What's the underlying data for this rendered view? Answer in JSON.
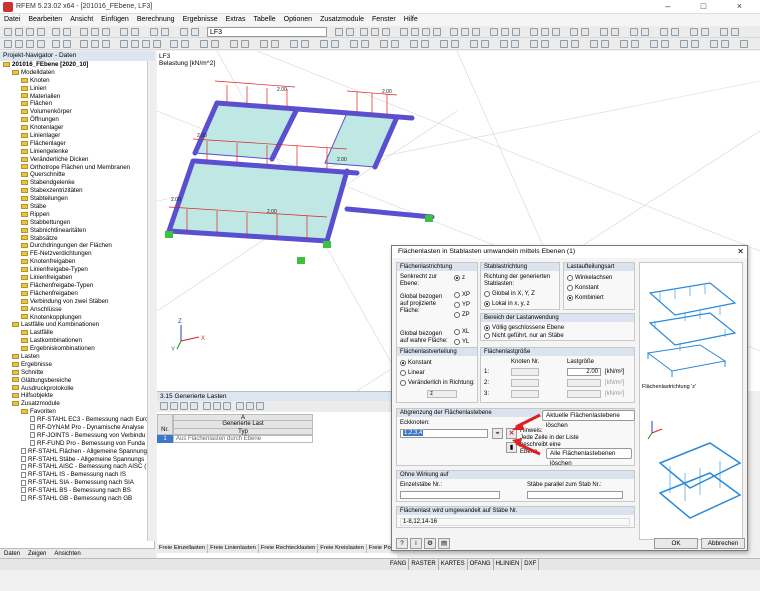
{
  "app": {
    "title": "RFEM 5.23.02 x64 - [201016_FEbene, LF3]",
    "load_case": "LF3",
    "menu": [
      "Datei",
      "Bearbeiten",
      "Ansicht",
      "Einfügen",
      "Berechnung",
      "Ergebnisse",
      "Extras",
      "Tabelle",
      "Optionen",
      "Zusatzmodule",
      "Fenster",
      "Hilfe"
    ]
  },
  "navigator": {
    "title": "Projekt-Navigator - Daten",
    "tree": [
      {
        "label": "201016_FEbene [2020_10]",
        "level": 0,
        "type": "folder"
      },
      {
        "label": "Modelldaten",
        "level": 1,
        "type": "folder"
      },
      {
        "label": "Knoten",
        "level": 2,
        "type": "folder"
      },
      {
        "label": "Linien",
        "level": 2,
        "type": "folder"
      },
      {
        "label": "Materialien",
        "level": 2,
        "type": "folder"
      },
      {
        "label": "Flächen",
        "level": 2,
        "type": "folder"
      },
      {
        "label": "Volumenkörper",
        "level": 2,
        "type": "folder"
      },
      {
        "label": "Öffnungen",
        "level": 2,
        "type": "folder"
      },
      {
        "label": "Knotenlager",
        "level": 2,
        "type": "folder"
      },
      {
        "label": "Linienlager",
        "level": 2,
        "type": "folder"
      },
      {
        "label": "Flächenlager",
        "level": 2,
        "type": "folder"
      },
      {
        "label": "Liniengelenke",
        "level": 2,
        "type": "folder"
      },
      {
        "label": "Veränderliche Dicken",
        "level": 2,
        "type": "folder"
      },
      {
        "label": "Orthotrope Flächen und Membranen",
        "level": 2,
        "type": "folder"
      },
      {
        "label": "Querschnitte",
        "level": 2,
        "type": "folder"
      },
      {
        "label": "Stabendgelenke",
        "level": 2,
        "type": "folder"
      },
      {
        "label": "Stabexzentrizitäten",
        "level": 2,
        "type": "folder"
      },
      {
        "label": "Stabteilungen",
        "level": 2,
        "type": "folder"
      },
      {
        "label": "Stäbe",
        "level": 2,
        "type": "folder"
      },
      {
        "label": "Rippen",
        "level": 2,
        "type": "folder"
      },
      {
        "label": "Stabbettungen",
        "level": 2,
        "type": "folder"
      },
      {
        "label": "Stabnichtlinearitäten",
        "level": 2,
        "type": "folder"
      },
      {
        "label": "Stabsätze",
        "level": 2,
        "type": "folder"
      },
      {
        "label": "Durchdringungen der Flächen",
        "level": 2,
        "type": "folder"
      },
      {
        "label": "FE-Netzverdichtungen",
        "level": 2,
        "type": "folder"
      },
      {
        "label": "Knotenfreigaben",
        "level": 2,
        "type": "folder"
      },
      {
        "label": "Linienfreigabe-Typen",
        "level": 2,
        "type": "folder"
      },
      {
        "label": "Linienfreigaben",
        "level": 2,
        "type": "folder"
      },
      {
        "label": "Flächenfreigabe-Typen",
        "level": 2,
        "type": "folder"
      },
      {
        "label": "Flächenfreigaben",
        "level": 2,
        "type": "folder"
      },
      {
        "label": "Verbindung von zwei Stäben",
        "level": 2,
        "type": "folder"
      },
      {
        "label": "Anschlüsse",
        "level": 2,
        "type": "folder"
      },
      {
        "label": "Knotenkopplungen",
        "level": 2,
        "type": "folder"
      },
      {
        "label": "Lastfälle und Kombinationen",
        "level": 1,
        "type": "folder"
      },
      {
        "label": "Lastfälle",
        "level": 2,
        "type": "folder"
      },
      {
        "label": "Lastkombinationen",
        "level": 2,
        "type": "folder"
      },
      {
        "label": "Ergebniskombinationen",
        "level": 2,
        "type": "folder"
      },
      {
        "label": "Lasten",
        "level": 1,
        "type": "folder"
      },
      {
        "label": "Ergebnisse",
        "level": 1,
        "type": "folder"
      },
      {
        "label": "Schnitte",
        "level": 1,
        "type": "folder"
      },
      {
        "label": "Glättungsbereiche",
        "level": 1,
        "type": "folder"
      },
      {
        "label": "Ausdruckprotokolle",
        "level": 1,
        "type": "folder"
      },
      {
        "label": "Hilfsobjekte",
        "level": 1,
        "type": "folder"
      },
      {
        "label": "Zusatzmodule",
        "level": 1,
        "type": "folder"
      },
      {
        "label": "Favoriten",
        "level": 2,
        "type": "folder"
      },
      {
        "label": "RF-STAHL EC3 - Bemessung nach Euro",
        "level": 3,
        "type": "doc"
      },
      {
        "label": "RF-DYNAM Pro - Dynamische Analyse",
        "level": 3,
        "type": "doc"
      },
      {
        "label": "RF-JOINTS - Bemessung von Verbindu",
        "level": 3,
        "type": "doc"
      },
      {
        "label": "RF-FUND Pro - Bemessung von Funda",
        "level": 3,
        "type": "doc"
      },
      {
        "label": "RF-STAHL Flächen - Allgemeine Spannung",
        "level": 2,
        "type": "doc"
      },
      {
        "label": "RF-STAHL Stäbe - Allgemeine Spannungs",
        "level": 2,
        "type": "doc"
      },
      {
        "label": "RF-STAHL AISC - Bemessung nach AISC (",
        "level": 2,
        "type": "doc"
      },
      {
        "label": "RF-STAHL IS - Bemessung nach IS",
        "level": 2,
        "type": "doc"
      },
      {
        "label": "RF-STAHL SIA - Bemessung nach SIA",
        "level": 2,
        "type": "doc"
      },
      {
        "label": "RF-STAHL BS - Bemessung nach BS",
        "level": 2,
        "type": "doc"
      },
      {
        "label": "RF-STAHL GB - Bemessung nach GB",
        "level": 2,
        "type": "doc"
      }
    ],
    "tabs": [
      "Daten",
      "Zeigen",
      "Ansichten"
    ]
  },
  "viewport": {
    "label1": "LF3",
    "label2": "Belastung [kN/m^2]",
    "load_value": "2.00",
    "axis_x": "X",
    "axis_y": "Y",
    "axis_z": "Z"
  },
  "table": {
    "title": "3.15 Generierte Lasten",
    "col_letter": "A",
    "col_header1": "Generierte Last",
    "col_header2": "Typ",
    "row_label": "Nr.",
    "row_no": "1",
    "row_value": "Aus Flächenlasten durch Ebene",
    "tabs": [
      "Freie Einzellasten",
      "Freie Linienlasten",
      "Freie Rechtecklasten",
      "Freie Kreislasten",
      "Freie Polygonlasten"
    ]
  },
  "statusbar": [
    "FANG",
    "RASTER",
    "KARTES",
    "OFANG",
    "HLINIEN",
    "DXF"
  ],
  "dialog": {
    "title": "Flächenlasten in Stablasten umwandeln mittels Ebenen   (1)",
    "g1": {
      "title": "Flächenlastrichtung",
      "senkrecht": "Senkrecht zur Ebene:",
      "z": "z",
      "global_proj": "Global bezogen auf projizierte Fläche:",
      "xp": "XP",
      "yp": "YP",
      "zp": "ZP",
      "global_wahr": "Global bezogen auf wahre Fläche:",
      "xl": "XL",
      "yl": "YL",
      "zl": "ZL"
    },
    "g2": {
      "title": "Stablastrichtung",
      "desc": "Richtung der generierten Stablasten:",
      "opt1": "Global in X, Y, Z",
      "opt2": "Lokal in x, y, z"
    },
    "g3": {
      "title": "Lastaufteilungsart",
      "opt1": "Winkelachsen",
      "opt2": "Konstant",
      "opt3": "Kombiniert"
    },
    "g4": {
      "title": "Bereich der Lastanwendung",
      "opt1": "Völlig geschlossene Ebene",
      "opt2": "Nicht geführt, nur an Stäbe"
    },
    "g5": {
      "title": "Flächenlastverteilung",
      "opt1": "Konstant",
      "opt2": "Linear",
      "opt3": "Veränderlich in Richtung:",
      "dir": "z"
    },
    "g6": {
      "title": "Flächenlastgröße",
      "col1": "Knoten Nr.",
      "col2": "Lastgröße",
      "r1": "1:",
      "r2": "2:",
      "r3": "3:",
      "value": "2.00",
      "unit": "[kN/m²]"
    },
    "g7": {
      "title": "Abgrenzung der Flächenlastebene",
      "label": "Eckknoten:",
      "value": "1,2,3,4",
      "hint_title": "Hinweis:",
      "hint": "Jede Zeile in der Liste beschreibt eine Ebene."
    },
    "g8": {
      "title": "Ohne Wirkung auf",
      "label1": "Einzelstäbe Nr.:",
      "label2": "Stäbe parallel zum Stab Nr.:"
    },
    "g9": {
      "title": "Flächenlast wird umgewandelt auf Stäbe Nr.",
      "value": "1-8,12,14-16"
    },
    "preview_caption": "Flächenlastrichtung 'z'",
    "ok": "OK",
    "cancel": "Abbrechen",
    "callout1": "Aktuelle Flächenlastebene löschen",
    "callout2": "Alle Flächenlastebenen löschen"
  },
  "colors": {
    "accent": "#3c78c8",
    "red_arrow": "#e02020",
    "support": "#3ec13e",
    "member": "#5a4fcf",
    "plate": "#bfe8e4"
  }
}
